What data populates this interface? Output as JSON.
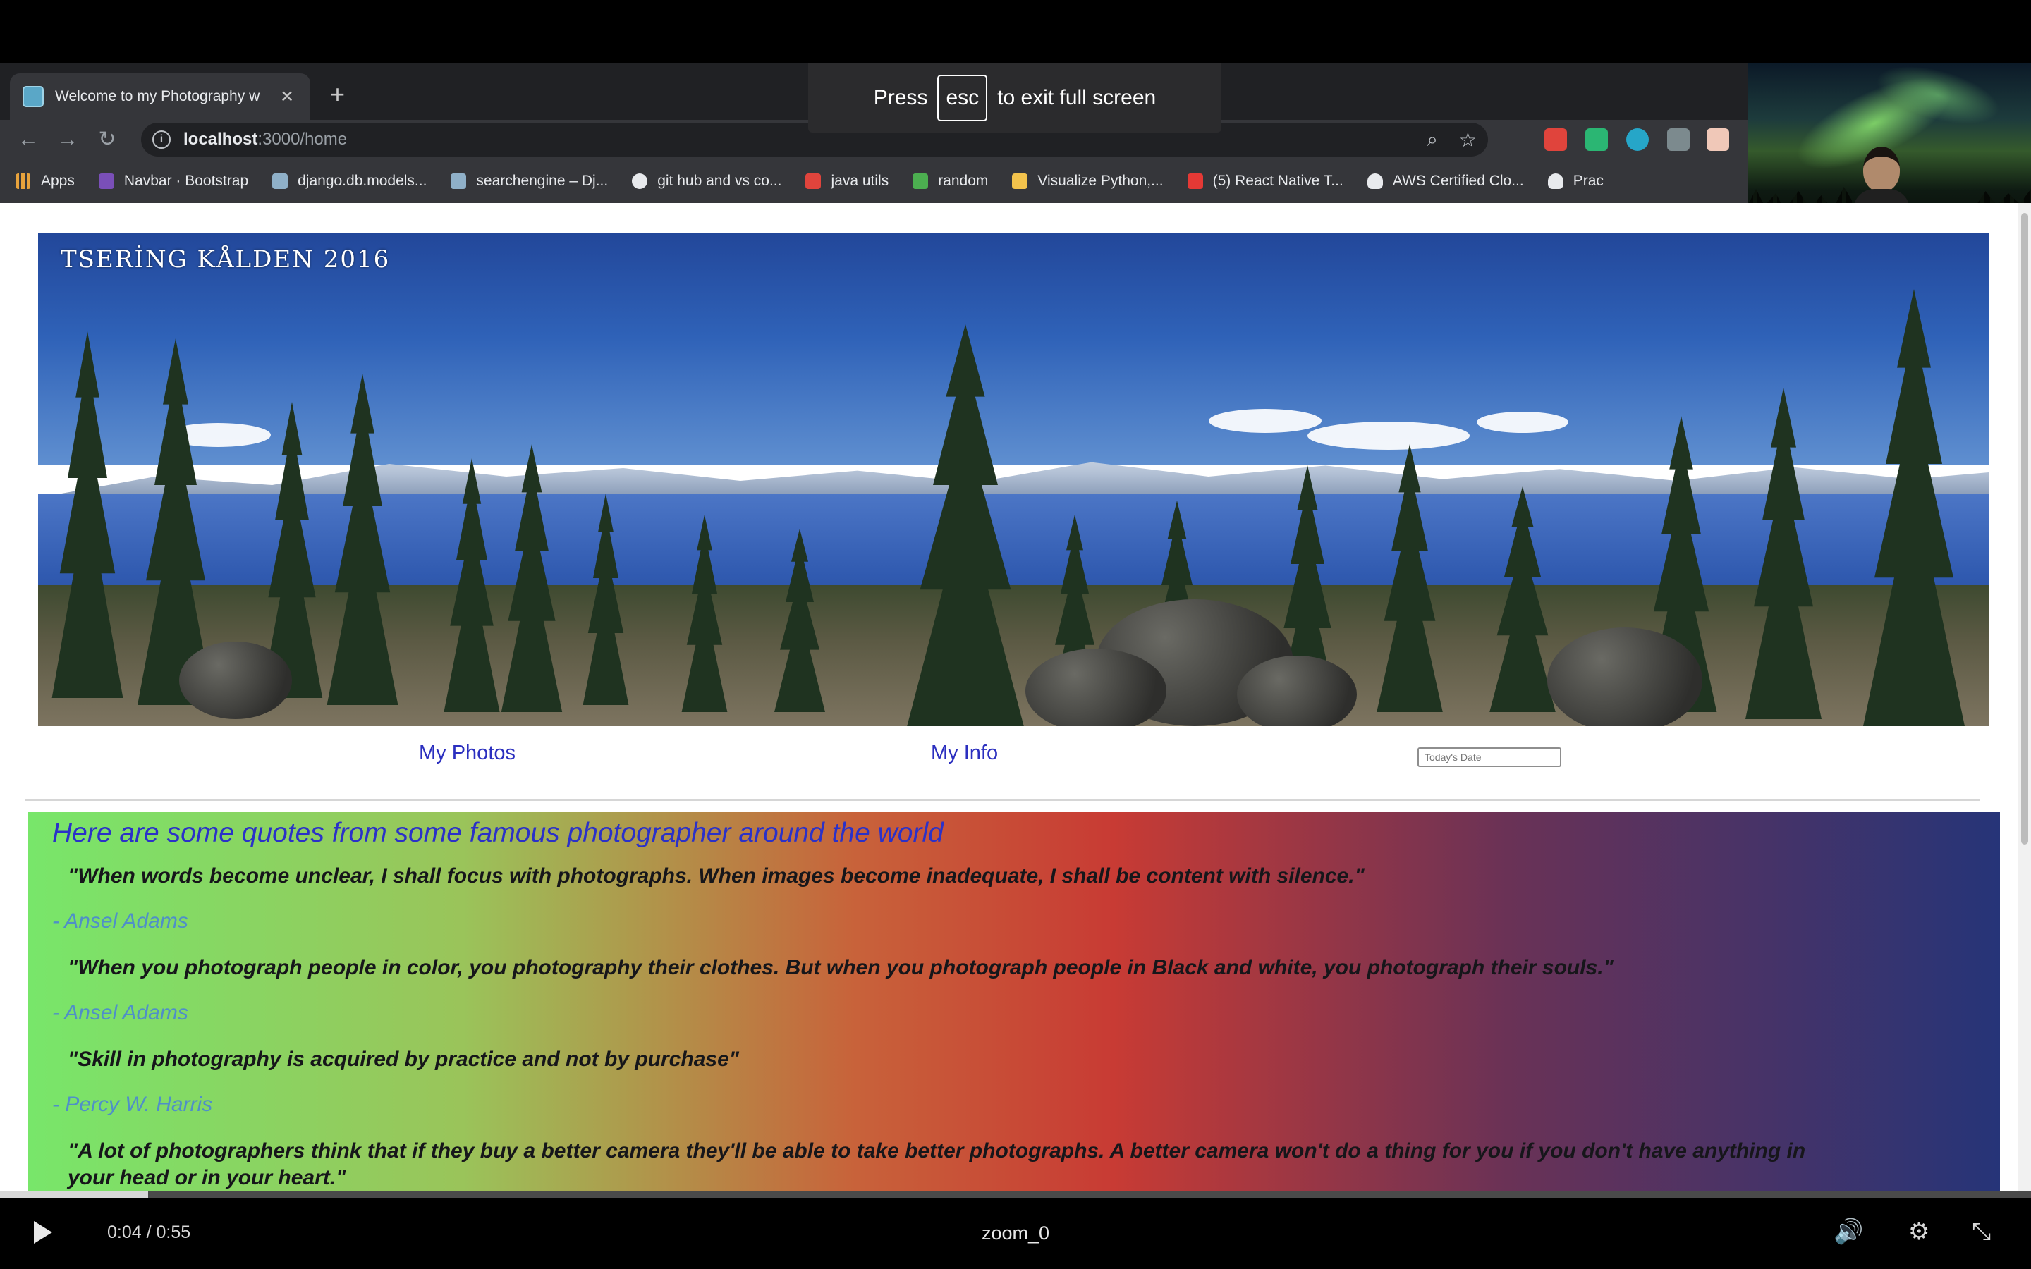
{
  "browser": {
    "tab_title": "Welcome to my Photography w",
    "tab_close": "✕",
    "new_tab": "+",
    "url_host": "localhost",
    "url_path": ":3000/home",
    "back": "←",
    "forward": "→",
    "reload": "↻",
    "info": "i",
    "zoom_icon": "⌕",
    "star_icon": "☆"
  },
  "bookmarks": [
    {
      "label": "Apps",
      "color": "#e8eaed"
    },
    {
      "label": "Navbar · Bootstrap",
      "color": "#7a4fb8"
    },
    {
      "label": "django.db.models...",
      "color": "#8fb0c8"
    },
    {
      "label": "searchengine – Dj...",
      "color": "#8fb0c8"
    },
    {
      "label": "git hub and vs co...",
      "color": "#e8eaed"
    },
    {
      "label": "java utils",
      "color": "#e0443c"
    },
    {
      "label": "random",
      "color": "#4caf50"
    },
    {
      "label": "Visualize Python,...",
      "color": "#f3c34c"
    },
    {
      "label": "(5) React Native T...",
      "color": "#e53935"
    },
    {
      "label": "AWS Certified Clo...",
      "color": "#e8eaed"
    },
    {
      "label": "Prac",
      "color": "#e8eaed"
    }
  ],
  "fullscreen_notice": {
    "prefix": "Press",
    "key": "esc",
    "suffix": "to exit full screen"
  },
  "page": {
    "banner_title": "TSERİNG KÅLDEN 2016",
    "nav": {
      "photos": "My Photos",
      "info": "My Info",
      "date_placeholder": "Today's Date"
    },
    "quotes_heading": "Here are some quotes from some famous photographer around the world",
    "quotes": [
      {
        "text": "\"When words become unclear, I shall focus with photographs. When images become inadequate, I shall be content with silence.\"",
        "author": "- Ansel Adams"
      },
      {
        "text": "\"When you photograph people in color, you photography their clothes. But when you photograph people in Black and white, you photograph their souls.\"",
        "author": "- Ansel Adams"
      },
      {
        "text": "\"Skill in photography is acquired by practice and not by purchase\"",
        "author": "- Percy W. Harris"
      },
      {
        "text_line1": "\"A lot of photographers think that if they buy a better camera they'll be able to take better photographs. A better camera won't do a thing for you if you don't have anything in",
        "text_line2": "your head or in your heart.\""
      }
    ]
  },
  "player": {
    "time": "0:04 / 0:55",
    "title": "zoom_0",
    "progress_fraction": 0.073,
    "volume_icon": "🔊",
    "settings_icon": "⚙",
    "exit_fullscreen_icon": "⤡"
  }
}
